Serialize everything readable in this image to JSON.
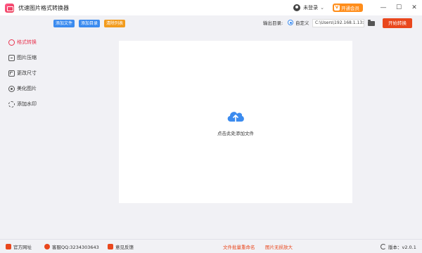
{
  "titlebar": {
    "app_title": "优速图片格式转换器",
    "login_label": "未登录",
    "vip_label": "开通会员",
    "vip_icon_text": "V",
    "chevron": "⌄",
    "minimize": "—",
    "maximize": "☐",
    "close": "✕"
  },
  "toolbar": {
    "add_file": "添加文件",
    "add_folder": "添加目录",
    "clear_list": "清除列表",
    "output_label": "输出目录:",
    "custom_label": "自定义",
    "output_path": "C:\\Users\\192.168.1.13>",
    "start_button": "开始转换"
  },
  "sidebar": {
    "items": [
      {
        "label": "格式转换",
        "icon": "convert-icon",
        "active": true
      },
      {
        "label": "图片压缩",
        "icon": "compress-icon",
        "active": false
      },
      {
        "label": "更改尺寸",
        "icon": "resize-icon",
        "active": false
      },
      {
        "label": "美化图片",
        "icon": "beautify-icon",
        "active": false
      },
      {
        "label": "添加水印",
        "icon": "watermark-icon",
        "active": false
      }
    ]
  },
  "main": {
    "drop_hint": "点击此处添加文件"
  },
  "footer": {
    "website": "官方网址",
    "qq": "客服QQ:3234303643",
    "feedback": "意见反馈",
    "batch_rename": "文件批量重命名",
    "lossless_enlarge": "图片无损放大",
    "version": "版本：v2.0.1"
  },
  "colors": {
    "accent_red": "#e9471d",
    "accent_blue": "#3b8bef",
    "accent_orange": "#f29b1d",
    "vip_orange": "#ff8d1a",
    "active_sidebar": "#e8344f"
  }
}
